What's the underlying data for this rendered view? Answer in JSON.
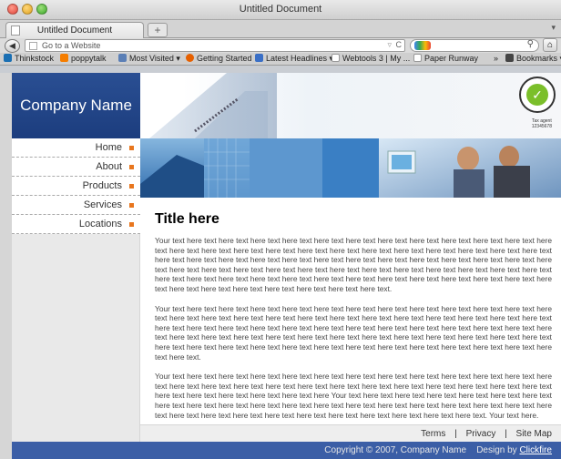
{
  "window": {
    "title": "Untitled Document"
  },
  "tabs": [
    {
      "label": "Untitled Document"
    }
  ],
  "newtab_label": "+",
  "nav": {
    "url_placeholder": "Go to a Website",
    "search_placeholder": ""
  },
  "bookmarks": [
    {
      "label": "Thinkstock",
      "icon": "thinkstock-icon",
      "color": "#1a6fb3"
    },
    {
      "label": "poppytalk",
      "icon": "blogger-icon",
      "color": "#f57d00"
    },
    {
      "label": "Most Visited ▾",
      "icon": "most-visited-icon",
      "color": "#5b7fb6"
    },
    {
      "label": "Getting Started",
      "icon": "firefox-icon",
      "color": "#e66000"
    },
    {
      "label": "Latest Headlines ▾",
      "icon": "rss-icon",
      "color": "#3a6fc6"
    },
    {
      "label": "Webtools 3 | My ...",
      "icon": "page-icon",
      "color": "#dddddd"
    },
    {
      "label": "Paper Runway",
      "icon": "page-icon",
      "color": "#dddddd"
    }
  ],
  "bookmarks_overflow": "»",
  "bookmarks_menu": "Bookmarks ▾",
  "site": {
    "company_name": "Company Name",
    "menu": [
      "Home",
      "About",
      "Products",
      "Services",
      "Locations"
    ],
    "tax_label_1": "Tax agent",
    "tax_label_2": "12345678",
    "title": "Title here",
    "paragraphs": [
      "Your text here text here text here text here text here text here text here text here text here text here text here text here text here text here text here text here text here text here text here text here text here text here text here text here text here text here text here text here text here text here text here text here text here text here text here text here text here text here text here text here text here text here text here text here text here text here text here text here text here text here text here text here text here text here text here text here text here text here text here text here text here text here text here text here text here text here text here text here text here text.",
      "Your text here text here text here text here text here text here text here text here text here text here text here text here text here text here text here text here text here text here text here text here text here text here text here text here text here text here text here text here text here text here text here text here text here text here text here text here text here text here text here text here text here text here text here text here text here text here text here text here text here text here text here text here text here text here text here text here text here text here text here text here text here text here text here text.",
      "Your text here text here text here text here text here text here text here text here text here text here text here text here text here text here text here text here text here text here text here text here text here text here text here text here text here text here text here text here text here text here Your text here text here text here text here text here text here text here text here text here text here text here text here text here text here text here text here text here text here text here text here text here text here text here text here text here text here text here text here text here text. Your text here."
    ],
    "footer_links": [
      "Terms",
      "Privacy",
      "Site Map"
    ],
    "footer_separator": "|",
    "copyright": "Copyright © 2007, Company Name",
    "design_by_label": "Design by",
    "design_by_link": "Clickfire"
  },
  "colors": {
    "logo_bg": "#1c3d7e",
    "footer_bg": "#3b5ea6",
    "menu_bullet": "#e8761e"
  }
}
